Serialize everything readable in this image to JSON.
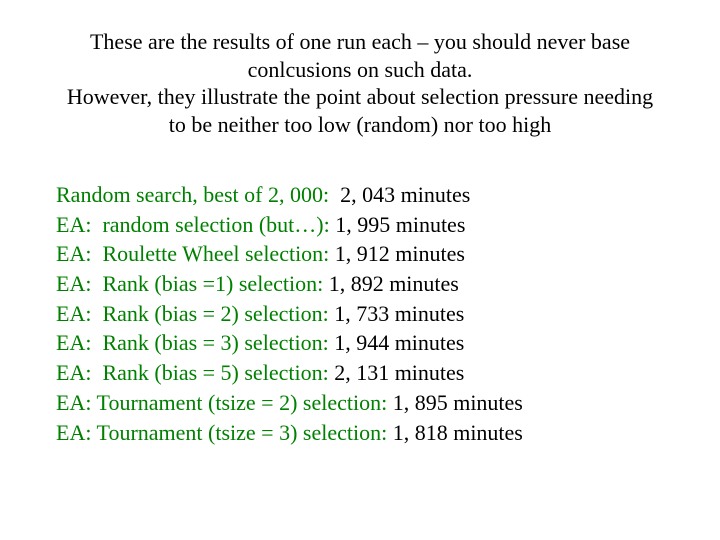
{
  "header": {
    "line1": "These are the results of one run each – you should never base conlcusions on such data.",
    "line2": "However, they illustrate the point about selection pressure needing to be neither too low (random) nor too high"
  },
  "results": [
    {
      "label": "Random search, best of 2, 000:  ",
      "value": "2, 043 minutes"
    },
    {
      "label": "EA:  random selection (but…): ",
      "value": "1, 995 minutes"
    },
    {
      "label": "EA:  Roulette Wheel selection: ",
      "value": "1, 912 minutes"
    },
    {
      "label": "EA:  Rank (bias =1) selection: ",
      "value": "1, 892 minutes"
    },
    {
      "label": "EA:  Rank (bias = 2) selection: ",
      "value": "1, 733 minutes"
    },
    {
      "label": "EA:  Rank (bias = 3) selection: ",
      "value": "1, 944 minutes"
    },
    {
      "label": "EA:  Rank (bias = 5) selection: ",
      "value": "2, 131 minutes"
    },
    {
      "label": "EA: Tournament (tsize = 2) selection: ",
      "value": "1, 895 minutes"
    },
    {
      "label": "EA: Tournament (tsize = 3) selection: ",
      "value": "1, 818 minutes"
    }
  ]
}
